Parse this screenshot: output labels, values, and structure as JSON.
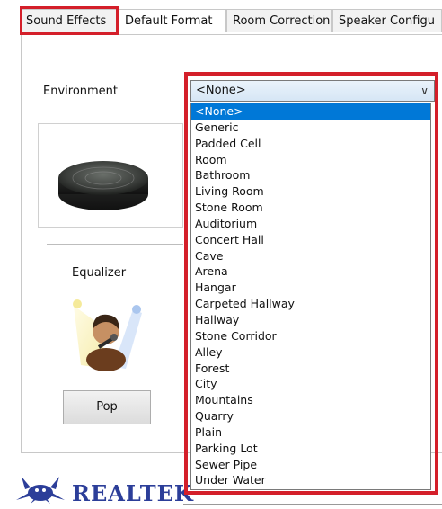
{
  "tabs": [
    "Sound Effects",
    "Default Format",
    "Room Correction",
    "Speaker Configu"
  ],
  "active_tab_index": 1,
  "environment": {
    "label": "Environment",
    "selected": "<None>",
    "options": [
      "<None>",
      "Generic",
      "Padded Cell",
      "Room",
      "Bathroom",
      "Living Room",
      "Stone Room",
      "Auditorium",
      "Concert Hall",
      "Cave",
      "Arena",
      "Hangar",
      "Carpeted Hallway",
      "Hallway",
      "Stone Corridor",
      "Alley",
      "Forest",
      "City",
      "Mountains",
      "Quarry",
      "Plain",
      "Parking Lot",
      "Sewer Pipe",
      "Under Water"
    ]
  },
  "equalizer": {
    "label": "Equalizer",
    "preset": "Pop"
  },
  "brand": {
    "name": "REALTEK"
  },
  "colors": {
    "highlight": "#d41f2a",
    "selection": "#0078d7",
    "brand": "#2c3e99"
  },
  "icons": [
    "environment-stone-icon",
    "singer-microphone-icon",
    "realtek-crab-logo-icon",
    "chevron-down-icon"
  ]
}
